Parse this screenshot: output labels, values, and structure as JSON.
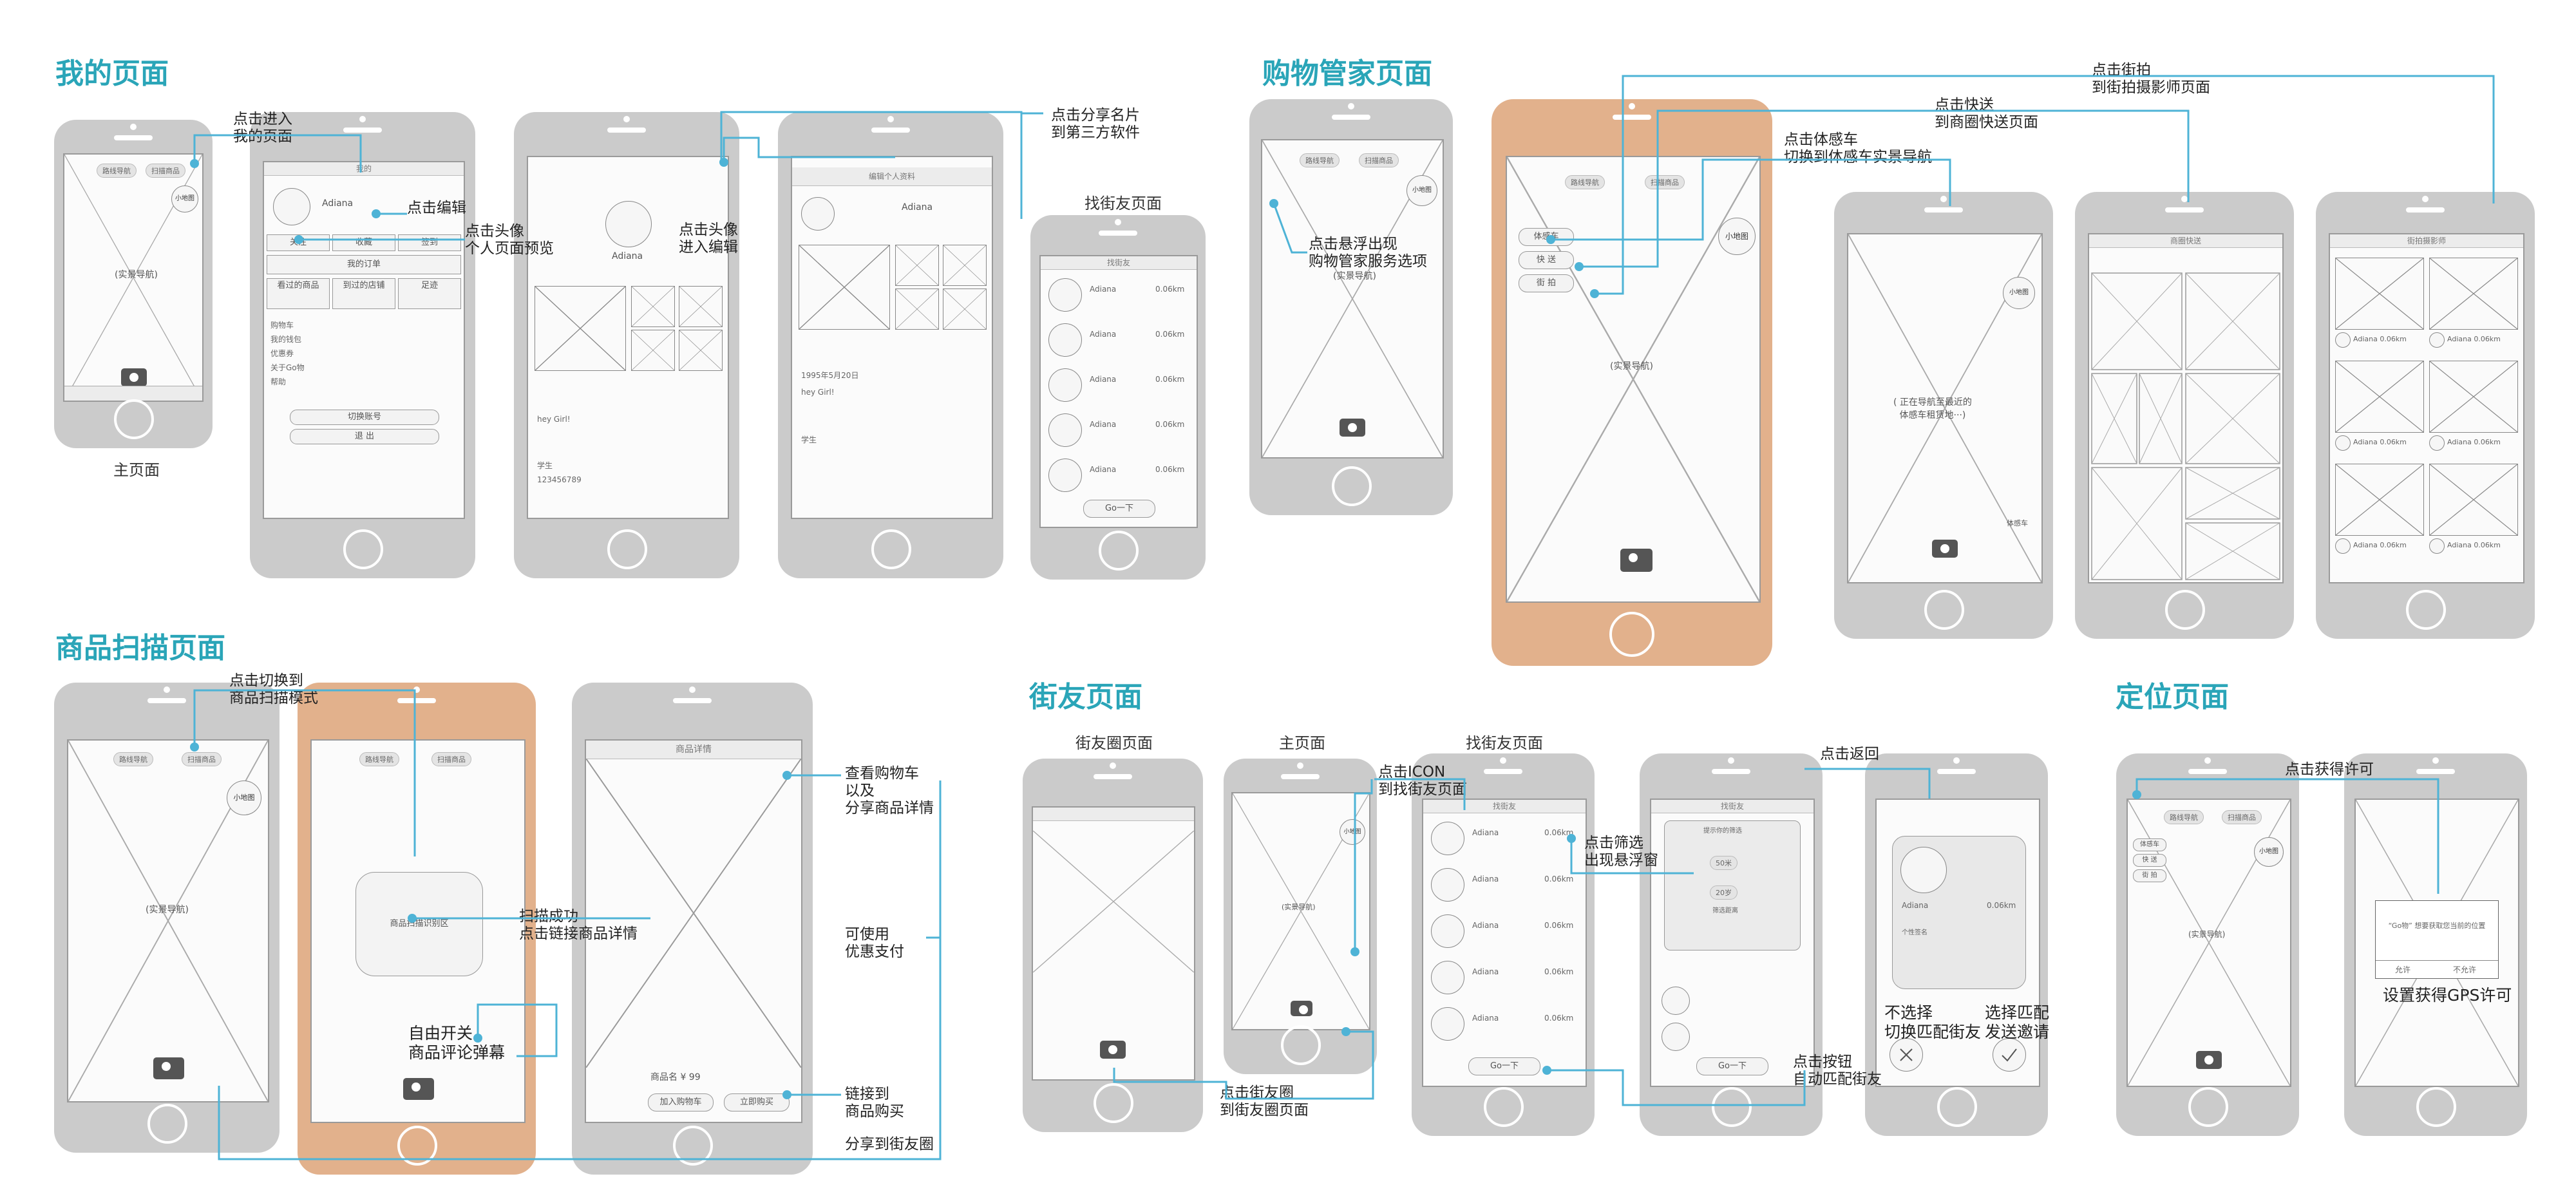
{
  "sections": {
    "my_page": "我的页面",
    "shopping": "购物管家页面",
    "scan": "商品扫描页面",
    "friends": "街友页面",
    "location": "定位页面"
  },
  "annotations": {
    "enter_my": "点击进入\n我的页面",
    "edit": "点击编辑",
    "avatar_preview": "点击头像\n个人页面预览",
    "avatar_edit": "点击头像\n进入编辑",
    "share_card": "点击分享名片\n到第三方软件",
    "street_photo": "点击街拍\n到街拍摄影师页面",
    "express": "点击快送\n到商圈快送页面",
    "experience_car": "点击体感车\n切换到体感车实景导航",
    "float_menu": "点击悬浮出现\n购物管家服务选项",
    "switch_scan": "点击切换到\n商品扫描模式",
    "scan_success": "扫描成功\n点击链接商品详情",
    "view_cart": "查看购物车\n以及\n分享商品详情",
    "coupon": "可使用\n优惠支付",
    "link_buy": "链接到\n商品购买",
    "share_circle": "分享到街友圈",
    "review_toggle": "自由开关\n商品评论弹幕",
    "click_icon": "点击ICON\n到找街友页面",
    "filter": "点击筛选\n出现悬浮窗",
    "back": "点击返回",
    "auto_match": "点击按钮\n自动匹配街友",
    "circle_nav": "点击街友圈\n到街友圈页面",
    "no_select": "不选择\n切换匹配街友",
    "select_match": "选择匹配\n发送邀请",
    "get_permission": "点击获得许可",
    "gps": "设置获得GPS许可"
  },
  "captions": {
    "home": "主页面",
    "find_friends": "找街友页面",
    "circle": "街友圈页面",
    "home2": "主页面",
    "find_friends2": "找街友页面"
  },
  "ui": {
    "realnav": "(实景导航)",
    "small_map": "小地图",
    "my": "我的",
    "adiana": "Adiana",
    "menu1": "关注",
    "menu2": "收藏",
    "menu3": "签到",
    "orders": "我的订单",
    "viewed": "看过的商品",
    "visited": "到过的店铺",
    "footprint": "足迹",
    "list1": "购物车",
    "list2": "我的钱包",
    "list3": "优惠券",
    "list4": "关于Go物",
    "list5": "帮助",
    "switch_account": "切换账号",
    "logout": "退 出",
    "edit_profile": "编辑个人资料",
    "find_friend_title": "找街友",
    "distance": "0.06km",
    "go": "Go一下",
    "nav_btn": "路线导航",
    "scan_btn": "扫描商品",
    "car": "体感车",
    "express": "快 送",
    "photo": "街 拍",
    "express_title": "商圈快送",
    "photographer_title": "街拍摄影师",
    "scan_area": "商品扫描识别区",
    "product_detail": "商品详情",
    "product_name": "商品名 ¥ 99",
    "add_cart": "加入购物车",
    "buy_now": "立即购买",
    "nav_loading": "( 正在导航至最近的\n体感车租赁地···)",
    "profile_name": "个性签名",
    "hey": "hey Girl!",
    "student": "学生",
    "phone_num": "123456789",
    "birthday": "1995年5月20日",
    "gps_dialog": "“Go物” 想要获取您当前的位置",
    "allow": "允许",
    "deny": "不允许",
    "filter_title": "提示你的筛选",
    "age": "50米",
    "count": "20岁",
    "street_label": "筛选距离"
  }
}
